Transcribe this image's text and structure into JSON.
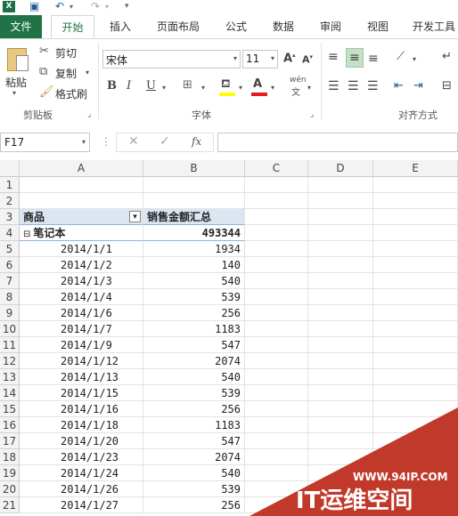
{
  "ribbon_tabs": [
    "文件",
    "开始",
    "插入",
    "页面布局",
    "公式",
    "数据",
    "审阅",
    "视图",
    "开发工具"
  ],
  "clipboard": {
    "paste": "粘贴",
    "cut": "剪切",
    "copy": "复制",
    "format_painter": "格式刷",
    "group": "剪贴板"
  },
  "font": {
    "name": "宋体",
    "size": "11",
    "group": "字体",
    "bold": "B",
    "italic": "I",
    "underline": "U",
    "phonetic": "wén"
  },
  "alignment": {
    "group": "对齐方式"
  },
  "formula_bar": {
    "name_box": "F17",
    "fx": "fx",
    "value": ""
  },
  "columns": [
    "A",
    "B",
    "C",
    "D",
    "E"
  ],
  "rows": [
    "1",
    "2",
    "3",
    "4",
    "5",
    "6",
    "7",
    "8",
    "9",
    "10",
    "11",
    "12",
    "13",
    "14",
    "15",
    "16",
    "17",
    "18",
    "19",
    "20",
    "21"
  ],
  "pivot": {
    "header_a": "商品",
    "header_b": "销售金额汇总",
    "group_label": "笔记本",
    "group_toggle": "⊟",
    "group_total": "493344",
    "items": [
      {
        "date": "2014/1/1",
        "amount": "1934"
      },
      {
        "date": "2014/1/2",
        "amount": "140"
      },
      {
        "date": "2014/1/3",
        "amount": "540"
      },
      {
        "date": "2014/1/4",
        "amount": "539"
      },
      {
        "date": "2014/1/6",
        "amount": "256"
      },
      {
        "date": "2014/1/7",
        "amount": "1183"
      },
      {
        "date": "2014/1/9",
        "amount": "547"
      },
      {
        "date": "2014/1/12",
        "amount": "2074"
      },
      {
        "date": "2014/1/13",
        "amount": "540"
      },
      {
        "date": "2014/1/15",
        "amount": "539"
      },
      {
        "date": "2014/1/16",
        "amount": "256"
      },
      {
        "date": "2014/1/18",
        "amount": "1183"
      },
      {
        "date": "2014/1/20",
        "amount": "547"
      },
      {
        "date": "2014/1/23",
        "amount": "2074"
      },
      {
        "date": "2014/1/24",
        "amount": "540"
      },
      {
        "date": "2014/1/26",
        "amount": "539"
      },
      {
        "date": "2014/1/27",
        "amount": "256"
      }
    ]
  },
  "watermark": {
    "url": "WWW.94IP.COM",
    "brand": "IT运维空间"
  },
  "colors": {
    "accent": "#217346",
    "pivot_header": "#dce6f1",
    "watermark": "#c0392b"
  }
}
